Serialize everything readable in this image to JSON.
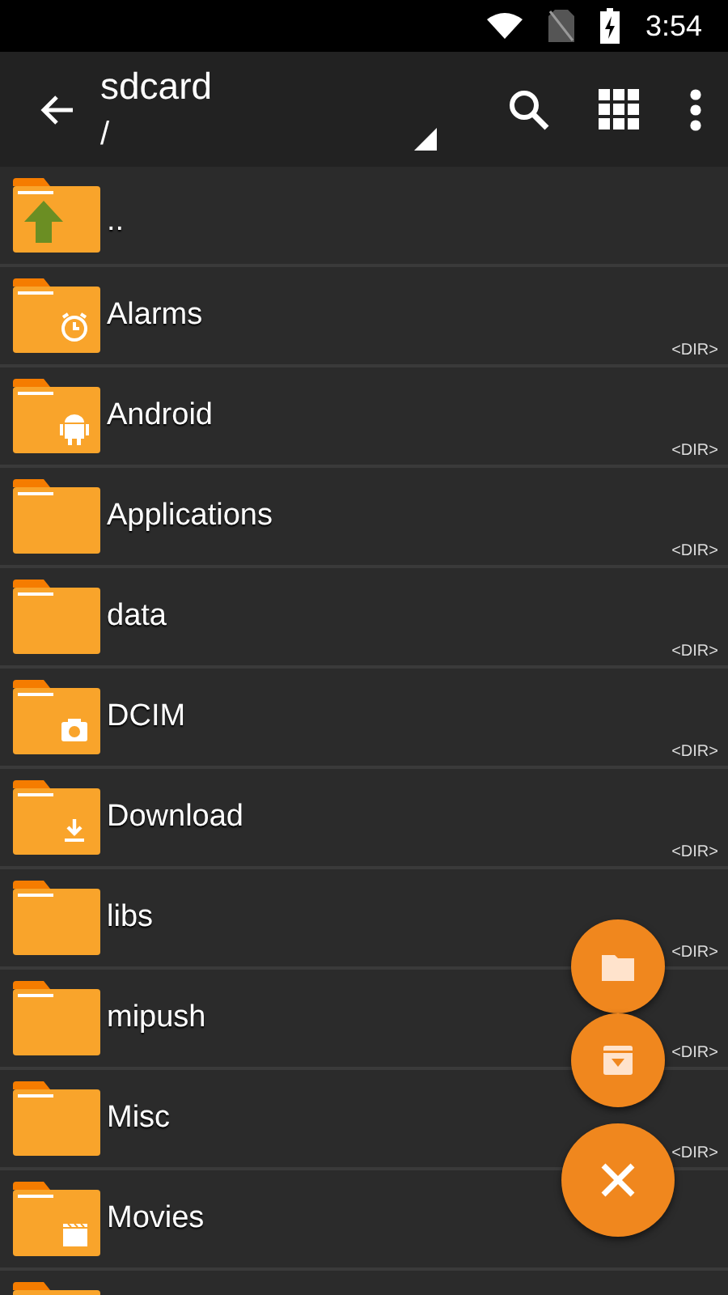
{
  "status_bar": {
    "time": "3:54"
  },
  "toolbar": {
    "title": "sdcard",
    "path": "/"
  },
  "items": [
    {
      "name": "..",
      "kind": "parent"
    },
    {
      "name": "Alarms",
      "kind": "alarm",
      "type_label": "<DIR>"
    },
    {
      "name": "Android",
      "kind": "android",
      "type_label": "<DIR>"
    },
    {
      "name": "Applications",
      "kind": "plain",
      "type_label": "<DIR>"
    },
    {
      "name": "data",
      "kind": "plain",
      "type_label": "<DIR>"
    },
    {
      "name": "DCIM",
      "kind": "camera",
      "type_label": "<DIR>"
    },
    {
      "name": "Download",
      "kind": "download",
      "type_label": "<DIR>"
    },
    {
      "name": "libs",
      "kind": "plain",
      "type_label": "<DIR>"
    },
    {
      "name": "mipush",
      "kind": "plain",
      "type_label": "<DIR>"
    },
    {
      "name": "Misc",
      "kind": "plain",
      "type_label": "<DIR>"
    },
    {
      "name": "Movies",
      "kind": "movie"
    },
    {
      "kind": "plain"
    }
  ],
  "fabs": [
    {
      "kind": "folder"
    },
    {
      "kind": "archive"
    },
    {
      "kind": "close"
    }
  ]
}
